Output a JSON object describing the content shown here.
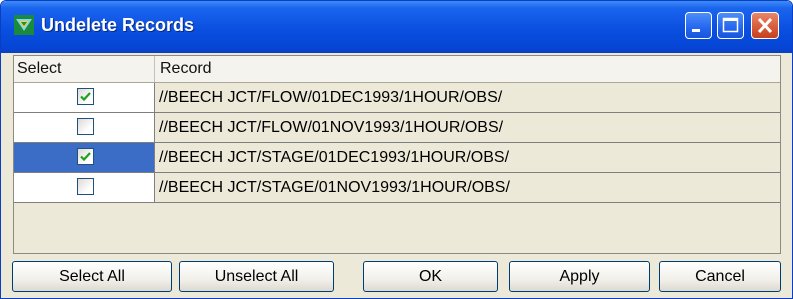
{
  "window": {
    "title": "Undelete Records",
    "title_bar_color": "#0a4fe0",
    "icon": "app-icon"
  },
  "title_buttons": {
    "minimize_icon": "minimize-icon",
    "maximize_icon": "maximize-icon",
    "close_icon": "close-icon"
  },
  "table": {
    "columns": [
      "Select",
      "Record"
    ],
    "rows": [
      {
        "checked": true,
        "selected": false,
        "record": "//BEECH JCT/FLOW/01DEC1993/1HOUR/OBS/"
      },
      {
        "checked": false,
        "selected": false,
        "record": "//BEECH JCT/FLOW/01NOV1993/1HOUR/OBS/"
      },
      {
        "checked": true,
        "selected": true,
        "record": "//BEECH JCT/STAGE/01DEC1993/1HOUR/OBS/"
      },
      {
        "checked": false,
        "selected": false,
        "record": "//BEECH JCT/STAGE/01NOV1993/1HOUR/OBS/"
      }
    ],
    "selection_color": "#3b6dc7",
    "check_color": "#21a121"
  },
  "buttons": {
    "select_all": "Select All",
    "unselect_all": "Unselect All",
    "ok": "OK",
    "apply": "Apply",
    "cancel": "Cancel"
  }
}
